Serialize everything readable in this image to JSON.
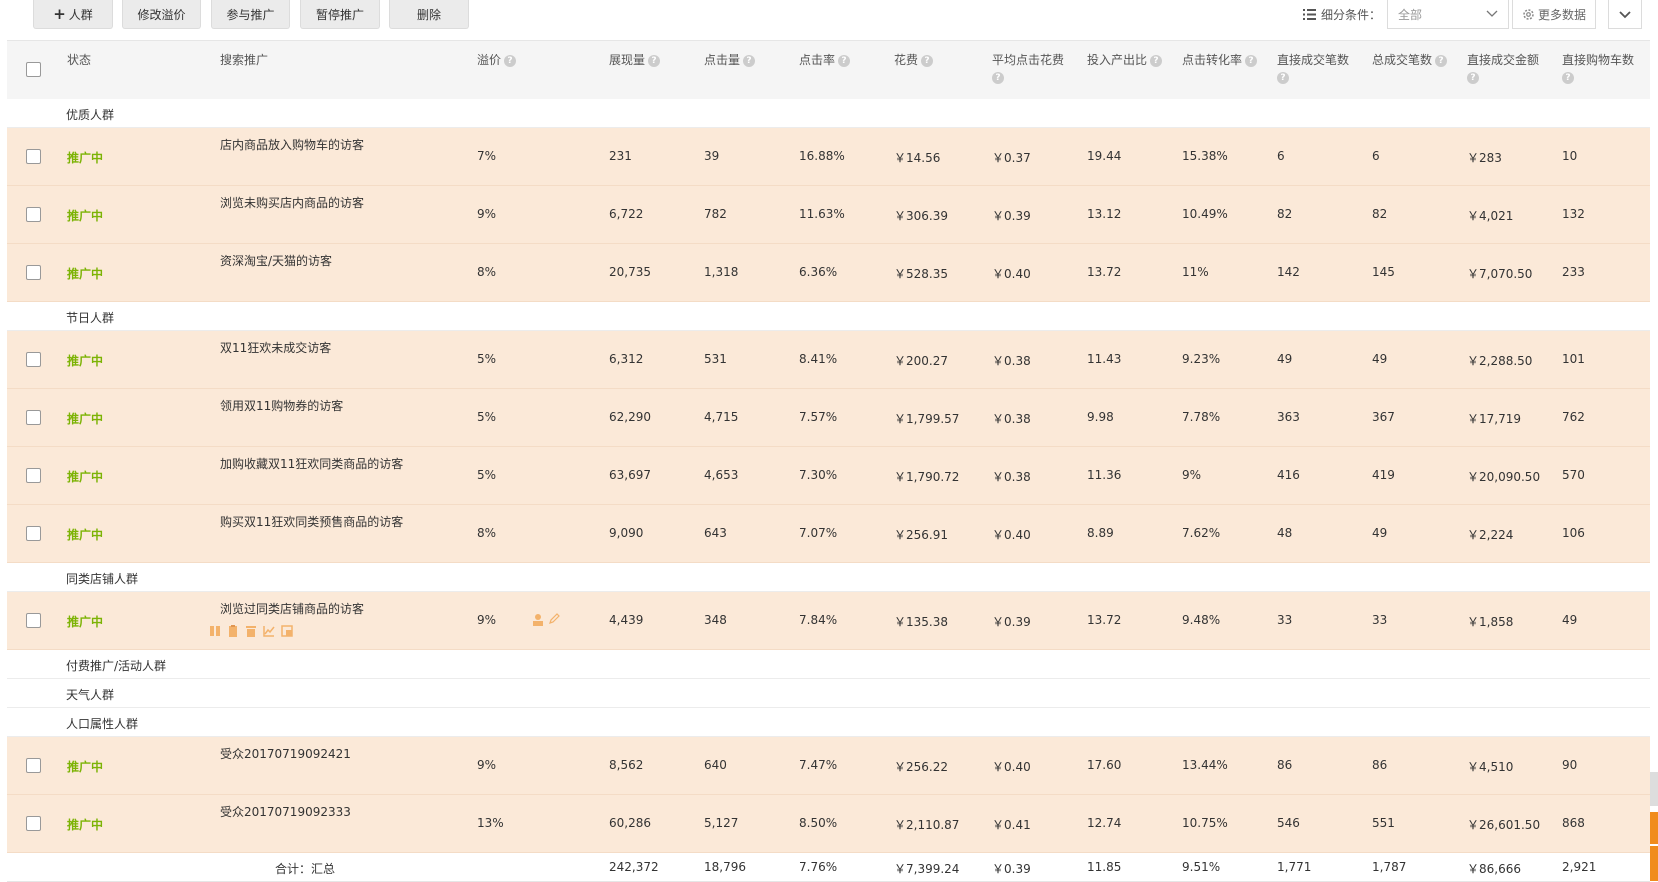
{
  "toolbar": {
    "add_label": "人群",
    "modify_premium": "修改溢价",
    "join_promo": "参与推广",
    "pause_promo": "暂停推广",
    "delete": "删除",
    "filter_label": "细分条件：",
    "filter_value": "全部",
    "more_data": "更多数据"
  },
  "columns": {
    "status": "状态",
    "search": "搜索推广",
    "premium": "溢价",
    "impressions": "展现量",
    "clicks": "点击量",
    "ctr": "点击率",
    "cost": "花费",
    "avg_cpc": "平均点击花费",
    "roi": "投入产出比",
    "cvr": "点击转化率",
    "direct_orders": "直接成交笔数",
    "total_orders": "总成交笔数",
    "direct_amount": "直接成交金额",
    "direct_cart": "直接购物车数"
  },
  "groups": [
    {
      "name": "优质人群",
      "rows": [
        {
          "status": "推广中",
          "name": "店内商品放入购物车的访客",
          "premium": "7%",
          "impressions": "231",
          "clicks": "39",
          "ctr": "16.88%",
          "cost": "￥14.56",
          "avg_cpc": "￥0.37",
          "roi": "19.44",
          "cvr": "15.38%",
          "direct_orders": "6",
          "total_orders": "6",
          "direct_amount": "￥283",
          "direct_cart": "10"
        },
        {
          "status": "推广中",
          "name": "浏览未购买店内商品的访客",
          "premium": "9%",
          "impressions": "6,722",
          "clicks": "782",
          "ctr": "11.63%",
          "cost": "￥306.39",
          "avg_cpc": "￥0.39",
          "roi": "13.12",
          "cvr": "10.49%",
          "direct_orders": "82",
          "total_orders": "82",
          "direct_amount": "￥4,021",
          "direct_cart": "132"
        },
        {
          "status": "推广中",
          "name": "资深淘宝/天猫的访客",
          "premium": "8%",
          "impressions": "20,735",
          "clicks": "1,318",
          "ctr": "6.36%",
          "cost": "￥528.35",
          "avg_cpc": "￥0.40",
          "roi": "13.72",
          "cvr": "11%",
          "direct_orders": "142",
          "total_orders": "145",
          "direct_amount": "￥7,070.50",
          "direct_cart": "233"
        }
      ]
    },
    {
      "name": "节日人群",
      "rows": [
        {
          "status": "推广中",
          "name": "双11狂欢未成交访客",
          "premium": "5%",
          "impressions": "6,312",
          "clicks": "531",
          "ctr": "8.41%",
          "cost": "￥200.27",
          "avg_cpc": "￥0.38",
          "roi": "11.43",
          "cvr": "9.23%",
          "direct_orders": "49",
          "total_orders": "49",
          "direct_amount": "￥2,288.50",
          "direct_cart": "101"
        },
        {
          "status": "推广中",
          "name": "领用双11购物券的访客",
          "premium": "5%",
          "impressions": "62,290",
          "clicks": "4,715",
          "ctr": "7.57%",
          "cost": "￥1,799.57",
          "avg_cpc": "￥0.38",
          "roi": "9.98",
          "cvr": "7.78%",
          "direct_orders": "363",
          "total_orders": "367",
          "direct_amount": "￥17,719",
          "direct_cart": "762"
        },
        {
          "status": "推广中",
          "name": "加购收藏双11狂欢同类商品的访客",
          "premium": "5%",
          "impressions": "63,697",
          "clicks": "4,653",
          "ctr": "7.30%",
          "cost": "￥1,790.72",
          "avg_cpc": "￥0.38",
          "roi": "11.36",
          "cvr": "9%",
          "direct_orders": "416",
          "total_orders": "419",
          "direct_amount": "￥20,090.50",
          "direct_cart": "570"
        },
        {
          "status": "推广中",
          "name": "购买双11狂欢同类预售商品的访客",
          "premium": "8%",
          "impressions": "9,090",
          "clicks": "643",
          "ctr": "7.07%",
          "cost": "￥256.91",
          "avg_cpc": "￥0.40",
          "roi": "8.89",
          "cvr": "7.62%",
          "direct_orders": "48",
          "total_orders": "49",
          "direct_amount": "￥2,224",
          "direct_cart": "106"
        }
      ]
    },
    {
      "name": "同类店铺人群",
      "rows": [
        {
          "status": "推广中",
          "name": "浏览过同类店铺商品的访客",
          "premium": "9%",
          "impressions": "4,439",
          "clicks": "348",
          "ctr": "7.84%",
          "cost": "￥135.38",
          "avg_cpc": "￥0.39",
          "roi": "13.72",
          "cvr": "9.48%",
          "direct_orders": "33",
          "total_orders": "33",
          "direct_amount": "￥1,858",
          "direct_cart": "49",
          "has_actions": true
        }
      ]
    },
    {
      "name": "付费推广/活动人群",
      "rows": []
    },
    {
      "name": "天气人群",
      "rows": []
    },
    {
      "name": "人口属性人群",
      "rows": [
        {
          "status": "推广中",
          "name": "受众20170719092421",
          "premium": "9%",
          "impressions": "8,562",
          "clicks": "640",
          "ctr": "7.47%",
          "cost": "￥256.22",
          "avg_cpc": "￥0.40",
          "roi": "17.60",
          "cvr": "13.44%",
          "direct_orders": "86",
          "total_orders": "86",
          "direct_amount": "￥4,510",
          "direct_cart": "90"
        },
        {
          "status": "推广中",
          "name": "受众20170719092333",
          "premium": "13%",
          "impressions": "60,286",
          "clicks": "5,127",
          "ctr": "8.50%",
          "cost": "￥2,110.87",
          "avg_cpc": "￥0.41",
          "roi": "12.74",
          "cvr": "10.75%",
          "direct_orders": "546",
          "total_orders": "551",
          "direct_amount": "￥26,601.50",
          "direct_cart": "868"
        }
      ]
    }
  ],
  "total": {
    "label": "合计：汇总",
    "impressions": "242,372",
    "clicks": "18,796",
    "ctr": "7.76%",
    "cost": "￥7,399.24",
    "avg_cpc": "￥0.39",
    "roi": "11.85",
    "cvr": "9.51%",
    "direct_orders": "1,771",
    "total_orders": "1,787",
    "direct_amount": "￥86,666",
    "direct_cart": "2,921"
  },
  "colors": {
    "status_green": "#7cb305",
    "row_bg": "#fbe9d8",
    "accent": "#f08c1e"
  }
}
